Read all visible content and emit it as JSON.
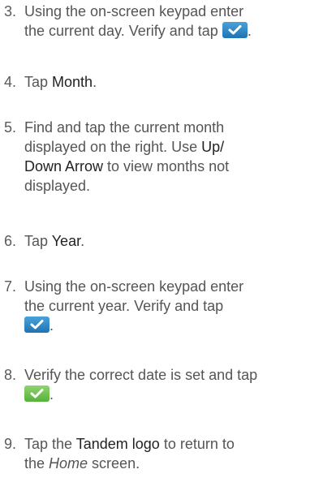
{
  "steps": [
    {
      "num": "3.",
      "lines": [
        "Using the on-screen keypad enter",
        "the current day. Verify and tap "
      ],
      "tail": "."
    },
    {
      "num": "4.",
      "pre": "Tap ",
      "bold": "Month",
      "post": "."
    },
    {
      "num": "5.",
      "l1": "Find and tap the current month",
      "l2": "displayed on the right. Use ",
      "b1": "Up/",
      "b2": "Down Arrow",
      "l3": " to view months not",
      "l4": "displayed."
    },
    {
      "num": "6.",
      "pre": "Tap ",
      "bold": "Year",
      "post": "."
    },
    {
      "num": "7.",
      "lines": [
        "Using the on-screen keypad enter",
        "the current year. Verify and tap"
      ],
      "tail": "."
    },
    {
      "num": "8.",
      "lines": [
        "Verify the correct date is set and tap"
      ],
      "tail": "."
    },
    {
      "num": "9.",
      "pre": "Tap the ",
      "bold": "Tandem logo",
      "post": " to return to",
      "l2pre": "the ",
      "italic": "Home",
      "l2post": " screen."
    }
  ],
  "icons": {
    "confirm_blue": "checkmark-button-blue",
    "confirm_green": "checkmark-button-green"
  },
  "colors": {
    "blue": "#2a82c4",
    "green": "#6cc24a",
    "text": "#555555"
  }
}
